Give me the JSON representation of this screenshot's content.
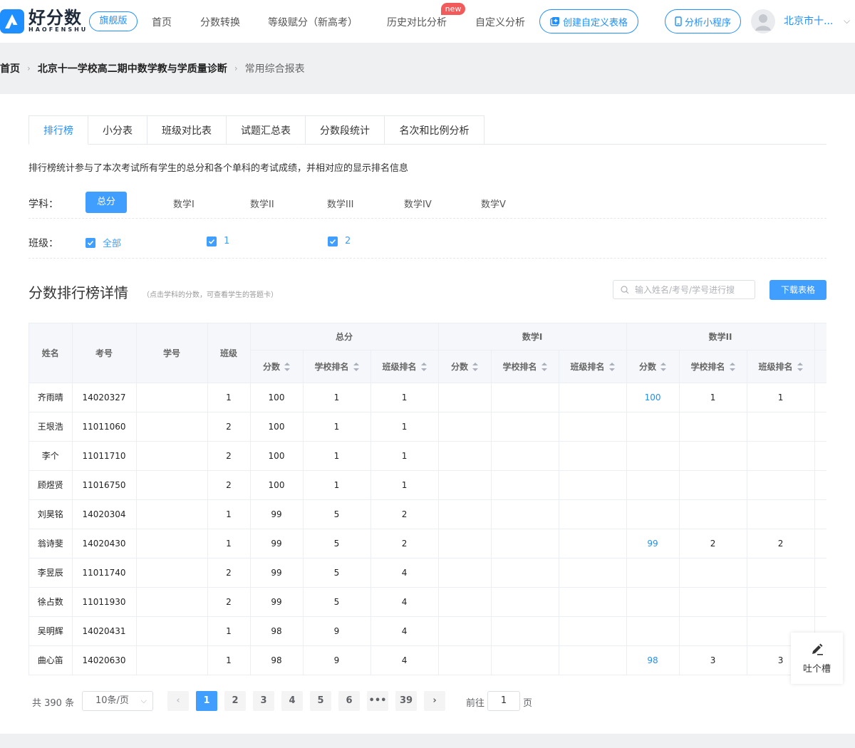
{
  "header": {
    "logo_cn": "好分数",
    "logo_en": "HAOFENSHU",
    "flagship_label": "旗舰版",
    "nav": [
      "首页",
      "分数转换",
      "等级赋分（新高考）",
      "历史对比分析",
      "自定义分析"
    ],
    "new_badge": "new",
    "create_table_label": "创建自定义表格",
    "mini_program_label": "分析小程序",
    "user_name": "北京市十..."
  },
  "breadcrumb": {
    "home": "首页",
    "exam": "北京十一学校高二期中数学教与学质量诊断",
    "current": "常用综合报表"
  },
  "tabs": [
    "排行榜",
    "小分表",
    "班级对比表",
    "试题汇总表",
    "分数段统计",
    "名次和比例分析"
  ],
  "description": "排行榜统计参与了本次考试所有学生的总分和各个单科的考试成绩，并相对应的显示排名信息",
  "filters": {
    "subject_label": "学科：",
    "subjects": [
      "总分",
      "数学I",
      "数学II",
      "数学III",
      "数学IV",
      "数学V"
    ],
    "class_label": "班级：",
    "classes": [
      "全部",
      "1",
      "2"
    ]
  },
  "section": {
    "title": "分数排行榜详情",
    "hint": "（点击学科的分数，可查看学生的答题卡）",
    "search_placeholder": "输入姓名/考号/学号进行搜",
    "download_label": "下载表格"
  },
  "table": {
    "col_name": "姓名",
    "col_id": "考号",
    "col_student_no": "学号",
    "col_class": "班级",
    "groups": [
      "总分",
      "数学I",
      "数学II"
    ],
    "sub_headers": [
      "分数",
      "学校排名",
      "班级排名"
    ],
    "rows": [
      {
        "name": "齐雨晴",
        "id": "14020327",
        "sno": "",
        "cls": "1",
        "t_score": "100",
        "t_school": "1",
        "t_class": "1",
        "m1_score": "",
        "m1_school": "",
        "m1_class": "",
        "m2_score": "100",
        "m2_school": "1",
        "m2_class": "1"
      },
      {
        "name": "王垠浩",
        "id": "11011060",
        "sno": "",
        "cls": "2",
        "t_score": "100",
        "t_school": "1",
        "t_class": "1",
        "m1_score": "",
        "m1_school": "",
        "m1_class": "",
        "m2_score": "",
        "m2_school": "",
        "m2_class": ""
      },
      {
        "name": "李个",
        "id": "11011710",
        "sno": "",
        "cls": "2",
        "t_score": "100",
        "t_school": "1",
        "t_class": "1",
        "m1_score": "",
        "m1_school": "",
        "m1_class": "",
        "m2_score": "",
        "m2_school": "",
        "m2_class": ""
      },
      {
        "name": "顾煜贤",
        "id": "11016750",
        "sno": "",
        "cls": "2",
        "t_score": "100",
        "t_school": "1",
        "t_class": "1",
        "m1_score": "",
        "m1_school": "",
        "m1_class": "",
        "m2_score": "",
        "m2_school": "",
        "m2_class": ""
      },
      {
        "name": "刘昊铭",
        "id": "14020304",
        "sno": "",
        "cls": "1",
        "t_score": "99",
        "t_school": "5",
        "t_class": "2",
        "m1_score": "",
        "m1_school": "",
        "m1_class": "",
        "m2_score": "",
        "m2_school": "",
        "m2_class": ""
      },
      {
        "name": "翁诗斐",
        "id": "14020430",
        "sno": "",
        "cls": "1",
        "t_score": "99",
        "t_school": "5",
        "t_class": "2",
        "m1_score": "",
        "m1_school": "",
        "m1_class": "",
        "m2_score": "99",
        "m2_school": "2",
        "m2_class": "2"
      },
      {
        "name": "李昱辰",
        "id": "11011740",
        "sno": "",
        "cls": "2",
        "t_score": "99",
        "t_school": "5",
        "t_class": "4",
        "m1_score": "",
        "m1_school": "",
        "m1_class": "",
        "m2_score": "",
        "m2_school": "",
        "m2_class": ""
      },
      {
        "name": "徐占数",
        "id": "11011930",
        "sno": "",
        "cls": "2",
        "t_score": "99",
        "t_school": "5",
        "t_class": "4",
        "m1_score": "",
        "m1_school": "",
        "m1_class": "",
        "m2_score": "",
        "m2_school": "",
        "m2_class": ""
      },
      {
        "name": "吴明辉",
        "id": "14020431",
        "sno": "",
        "cls": "1",
        "t_score": "98",
        "t_school": "9",
        "t_class": "4",
        "m1_score": "",
        "m1_school": "",
        "m1_class": "",
        "m2_score": "",
        "m2_school": "",
        "m2_class": ""
      },
      {
        "name": "曲心笛",
        "id": "14020630",
        "sno": "",
        "cls": "1",
        "t_score": "98",
        "t_school": "9",
        "t_class": "4",
        "m1_score": "",
        "m1_school": "",
        "m1_class": "",
        "m2_score": "98",
        "m2_school": "3",
        "m2_class": "3"
      }
    ]
  },
  "feedback_label": "吐个槽",
  "pagination": {
    "total": "共 390 条",
    "page_size": "10条/页",
    "pages": [
      "1",
      "2",
      "3",
      "4",
      "5",
      "6",
      "•••",
      "39"
    ],
    "current": "1",
    "goto_prefix": "前往",
    "goto_value": "1",
    "goto_suffix": "页"
  },
  "colors": {
    "accent": "#409eff",
    "brand": "#1f8fff",
    "badge": "#f25b5b"
  }
}
